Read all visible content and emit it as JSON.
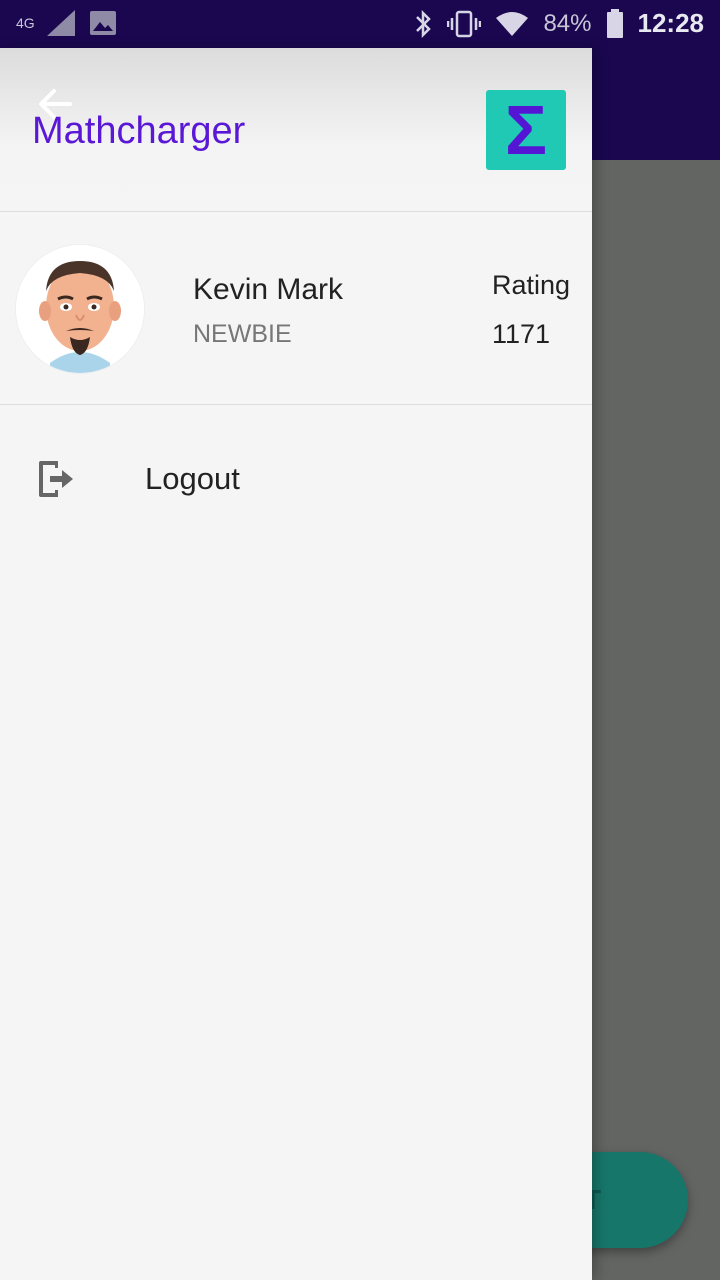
{
  "status_bar": {
    "network": "4G",
    "battery": "84%",
    "time": "12:28",
    "icons": [
      "signal-icon",
      "image-notification-icon",
      "bluetooth-icon",
      "vibrate-icon",
      "wifi-icon",
      "battery-icon"
    ]
  },
  "drawer": {
    "title": "Mathcharger",
    "logo_glyph": "Σ",
    "user": {
      "name": "Kevin Mark",
      "rank": "NEWBIE",
      "rating_label": "Rating",
      "rating_value": "1171"
    },
    "menu": [
      {
        "label": "Logout",
        "icon": "logout-icon"
      }
    ]
  },
  "background_app": {
    "fab_partial_text": "GHT"
  },
  "colors": {
    "primary_dark": "#1a0750",
    "title_purple": "#5a18d6",
    "logo_teal": "#20c9b3",
    "fab_teal": "#17766a",
    "scrim_gray": "#636563"
  }
}
